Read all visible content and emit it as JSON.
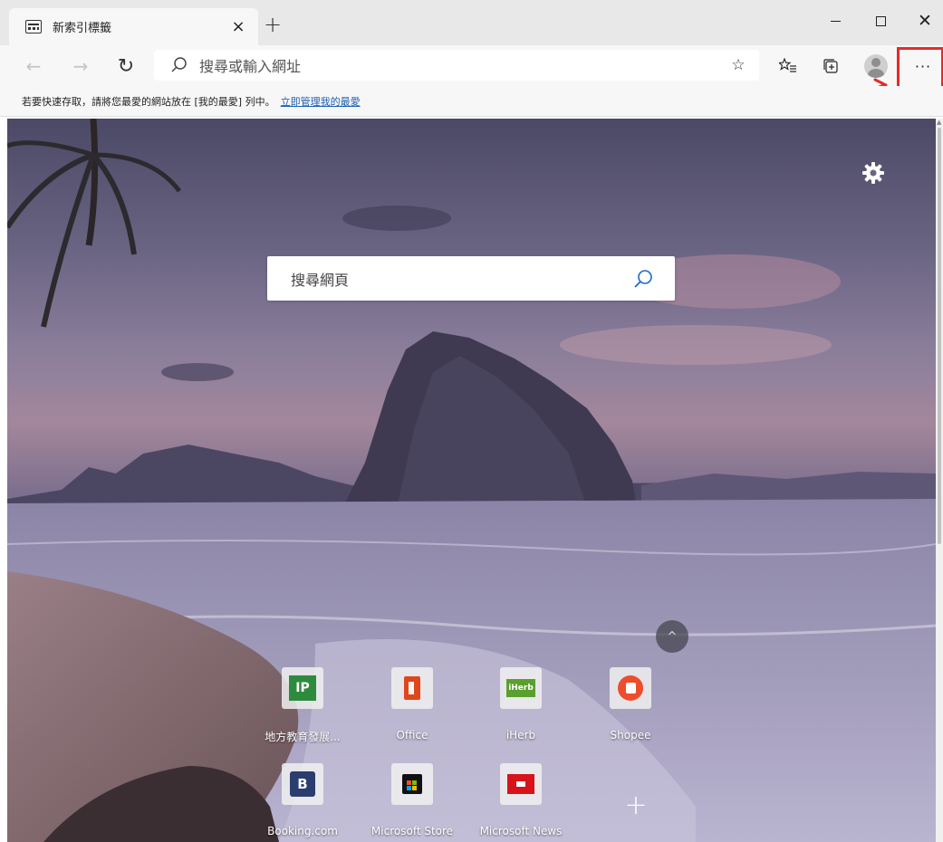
{
  "tab": {
    "title": "新索引標籤",
    "close_label": "×",
    "new_tab_label": "+"
  },
  "window_controls": {
    "minimize": "minimize",
    "maximize": "maximize",
    "close_label": "✕"
  },
  "toolbar": {
    "back_label": "←",
    "forward_label": "→",
    "refresh_label": "↻",
    "address_placeholder": "搜尋或輸入網址",
    "favorite_star_label": "☆",
    "favorites_label": "☆≡",
    "collections_label": "⧉",
    "more_label": "···"
  },
  "hintbar": {
    "text": "若要快速存取，請將您最愛的網站放在 [我的最愛] 列中。",
    "link": "立即管理我的最愛"
  },
  "ntp": {
    "search_placeholder": "搜尋網頁",
    "collapse_label": "^",
    "add_tile_label": "+",
    "tiles": [
      {
        "label": "地方教育發展...",
        "icon": "ip-icon",
        "logo_text": "IP"
      },
      {
        "label": "Office",
        "icon": "office-icon",
        "logo_text": ""
      },
      {
        "label": "iHerb",
        "icon": "iherb-icon",
        "logo_text": "iHerb"
      },
      {
        "label": "Shopee",
        "icon": "shopee-icon",
        "logo_text": ""
      },
      {
        "label": "Booking.com",
        "icon": "booking-icon",
        "logo_text": "B"
      },
      {
        "label": "Microsoft Store",
        "icon": "store-icon",
        "logo_text": ""
      },
      {
        "label": "Microsoft News",
        "icon": "news-icon",
        "logo_text": ""
      }
    ]
  },
  "colors": {
    "highlight": "#e52b2b",
    "link": "#1a5fb4",
    "chrome_bg": "#f7f7f7",
    "titlebar_bg": "#e8e8e8"
  }
}
